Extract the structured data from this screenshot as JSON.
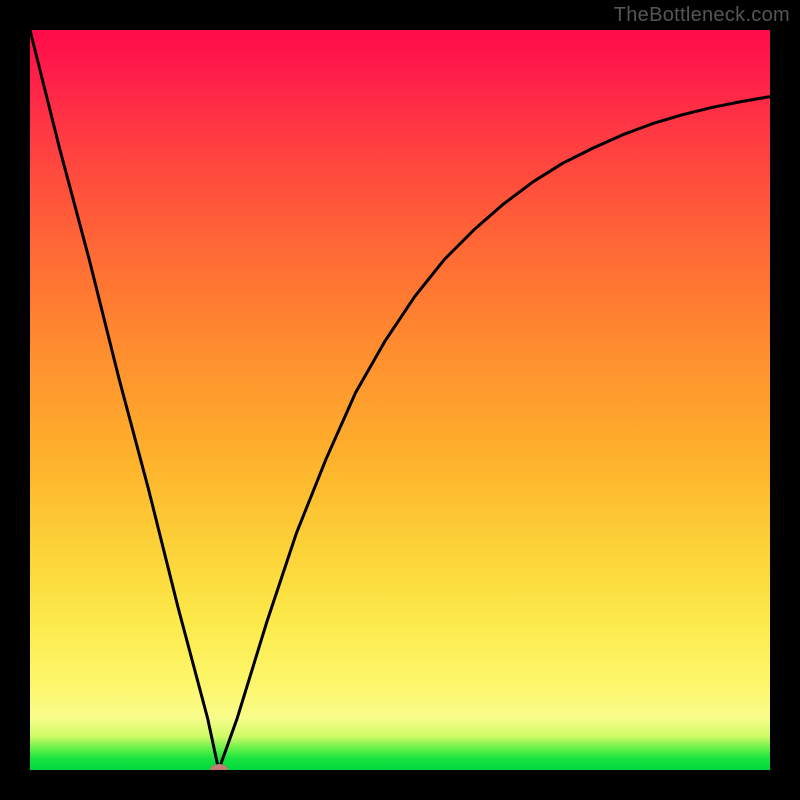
{
  "watermark": "TheBottleneck.com",
  "colors": {
    "frame": "#000000",
    "curve": "#000000",
    "marker": "#c47c77"
  },
  "chart_data": {
    "type": "line",
    "title": "",
    "xlabel": "",
    "ylabel": "",
    "xlim": [
      0,
      100
    ],
    "ylim": [
      0,
      100
    ],
    "grid": false,
    "legend": false,
    "series": [
      {
        "name": "bottleneck-curve",
        "x": [
          0,
          4,
          8,
          12,
          16,
          20,
          24,
          25.5,
          28,
          32,
          36,
          40,
          44,
          48,
          52,
          56,
          60,
          64,
          68,
          72,
          76,
          80,
          84,
          88,
          92,
          96,
          100
        ],
        "y": [
          100,
          84,
          69,
          53,
          38,
          22,
          7,
          0,
          7,
          20,
          32,
          42,
          51,
          58,
          64,
          69,
          73,
          76.5,
          79.5,
          82,
          84,
          85.8,
          87.3,
          88.5,
          89.5,
          90.3,
          91
        ]
      }
    ],
    "minimum_point": {
      "x": 25.5,
      "y": 0
    },
    "background_gradient": {
      "direction": "vertical",
      "stops": [
        {
          "pos": 0.0,
          "color": "#ff0b4a"
        },
        {
          "pos": 0.3,
          "color": "#ff6a35"
        },
        {
          "pos": 0.58,
          "color": "#feb22c"
        },
        {
          "pos": 0.8,
          "color": "#fcea4a"
        },
        {
          "pos": 0.95,
          "color": "#cdfa66"
        },
        {
          "pos": 1.0,
          "color": "#00d93f"
        }
      ]
    }
  }
}
